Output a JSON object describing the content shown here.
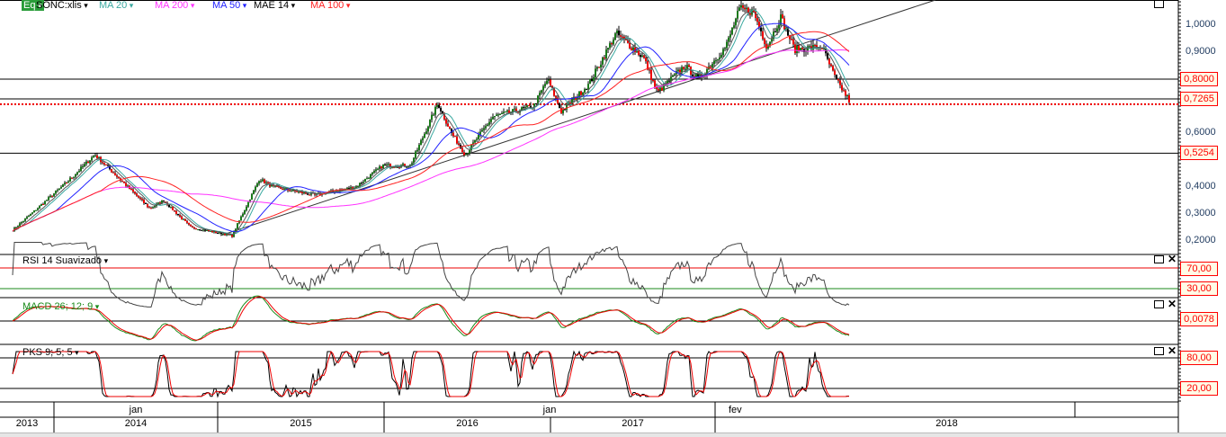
{
  "legend": {
    "symbol_badge": "Eq",
    "symbol": "SONC:xlis",
    "items": [
      {
        "label": "MA 20",
        "color": "#3aa9a0"
      },
      {
        "label": "MA 200",
        "color": "#ff33ff"
      },
      {
        "label": "MA 50",
        "color": "#2222ff"
      },
      {
        "label": "MAE 14",
        "color": "#000000"
      },
      {
        "label": "MA 100",
        "color": "#ff2222"
      }
    ]
  },
  "price_axis": {
    "ticks": [
      "1,0000",
      "0,9000",
      "0,6000",
      "0,4000",
      "0,3000",
      "0,2000"
    ],
    "tick_values": [
      1.0,
      0.9,
      0.6,
      0.4,
      0.3,
      0.2
    ],
    "levels": [
      {
        "label": "0,8000",
        "value": 0.8
      },
      {
        "label": "0,7265",
        "value": 0.7265
      },
      {
        "label": "0,5254",
        "value": 0.5254
      }
    ],
    "last_price_line": 0.707
  },
  "panels": {
    "rsi": {
      "title": "RSI 14 Suavizado",
      "levels": [
        "70,00",
        "30,00"
      ]
    },
    "macd": {
      "title": "MACD 26; 12; 9",
      "level": "0,0078"
    },
    "pks": {
      "title": "PKS 9; 5; 5",
      "levels": [
        "80,00",
        "20,00"
      ]
    }
  },
  "time_axis": {
    "months": [
      "jan",
      "jan",
      "fev"
    ],
    "years": [
      "2013",
      "2014",
      "2015",
      "2016",
      "2017",
      "2018"
    ]
  },
  "chart_data": {
    "type": "candlestick",
    "symbol": "SONC:xlis",
    "ylim": [
      0.17,
      1.08
    ],
    "closes": [
      {
        "date": "2013-09",
        "close": 0.24
      },
      {
        "date": "2013-11",
        "close": 0.33
      },
      {
        "date": "2014-01",
        "close": 0.42
      },
      {
        "date": "2014-03",
        "close": 0.52
      },
      {
        "date": "2014-05",
        "close": 0.42
      },
      {
        "date": "2014-07",
        "close": 0.32
      },
      {
        "date": "2014-08",
        "close": 0.35
      },
      {
        "date": "2014-10",
        "close": 0.25
      },
      {
        "date": "2015-01",
        "close": 0.22
      },
      {
        "date": "2015-03",
        "close": 0.43
      },
      {
        "date": "2015-04",
        "close": 0.4
      },
      {
        "date": "2015-07",
        "close": 0.37
      },
      {
        "date": "2015-10",
        "close": 0.4
      },
      {
        "date": "2015-12",
        "close": 0.48
      },
      {
        "date": "2016-02",
        "close": 0.48
      },
      {
        "date": "2016-04",
        "close": 0.71
      },
      {
        "date": "2016-05",
        "close": 0.6
      },
      {
        "date": "2016-06",
        "close": 0.52
      },
      {
        "date": "2016-08",
        "close": 0.66
      },
      {
        "date": "2016-11",
        "close": 0.7
      },
      {
        "date": "2016-12",
        "close": 0.8
      },
      {
        "date": "2017-01",
        "close": 0.68
      },
      {
        "date": "2017-03",
        "close": 0.78
      },
      {
        "date": "2017-05",
        "close": 0.97
      },
      {
        "date": "2017-07",
        "close": 0.88
      },
      {
        "date": "2017-08",
        "close": 0.75
      },
      {
        "date": "2017-10",
        "close": 0.85
      },
      {
        "date": "2017-11",
        "close": 0.8
      },
      {
        "date": "2018-01",
        "close": 0.92
      },
      {
        "date": "2018-02",
        "close": 1.06
      },
      {
        "date": "2018-03",
        "close": 1.05
      },
      {
        "date": "2018-04",
        "close": 0.92
      },
      {
        "date": "2018-05",
        "close": 1.03
      },
      {
        "date": "2018-06",
        "close": 0.91
      },
      {
        "date": "2018-08",
        "close": 0.92
      },
      {
        "date": "2018-09",
        "close": 0.8
      },
      {
        "date": "2018-10",
        "close": 0.72
      }
    ]
  }
}
